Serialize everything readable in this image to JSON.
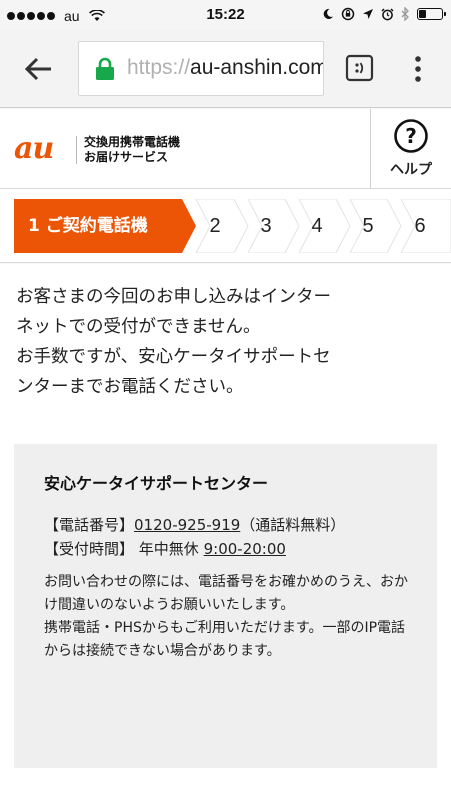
{
  "status_bar": {
    "carrier": "au",
    "time": "15:22",
    "signal_bars": 5,
    "battery_level": 0.3,
    "icons": [
      "moon-icon",
      "rotation-lock-icon",
      "location-icon",
      "alarm-icon",
      "bluetooth-icon",
      "battery-icon"
    ]
  },
  "browser": {
    "url_scheme": "https://",
    "url_host": "au-anshin.com",
    "lock_color": "#16a84b"
  },
  "site": {
    "logo_text": "au",
    "service_line1": "交換用携帯電話機",
    "service_line2": "お届けサービス",
    "help_label": "ヘルプ",
    "accent_color": "#eb5505"
  },
  "steps": {
    "active_label": "1 ご契約電話機",
    "items": [
      "2",
      "3",
      "4",
      "5",
      "6"
    ]
  },
  "message": {
    "line1": "お客さまの今回のお申し込みはインター",
    "line2": "ネットでの受付ができません。",
    "line3": "お手数ですが、安心ケータイサポートセ",
    "line4": "ンターまでお電話ください。"
  },
  "info": {
    "title": "安心ケータイサポートセンター",
    "phone_label": "【電話番号】",
    "phone_number": "0120-925-919",
    "phone_note": "（通話料無料）",
    "hours_label": "【受付時間】",
    "hours_days": "年中無休",
    "hours_time": "9:00-20:00",
    "note1": "お問い合わせの際には、電話番号をお確かめのうえ、おかけ間違いのないようお願いいたします。",
    "note2": "携帯電話・PHSからもご利用いただけます。一部のIP電話からは接続できない場合があります。"
  }
}
